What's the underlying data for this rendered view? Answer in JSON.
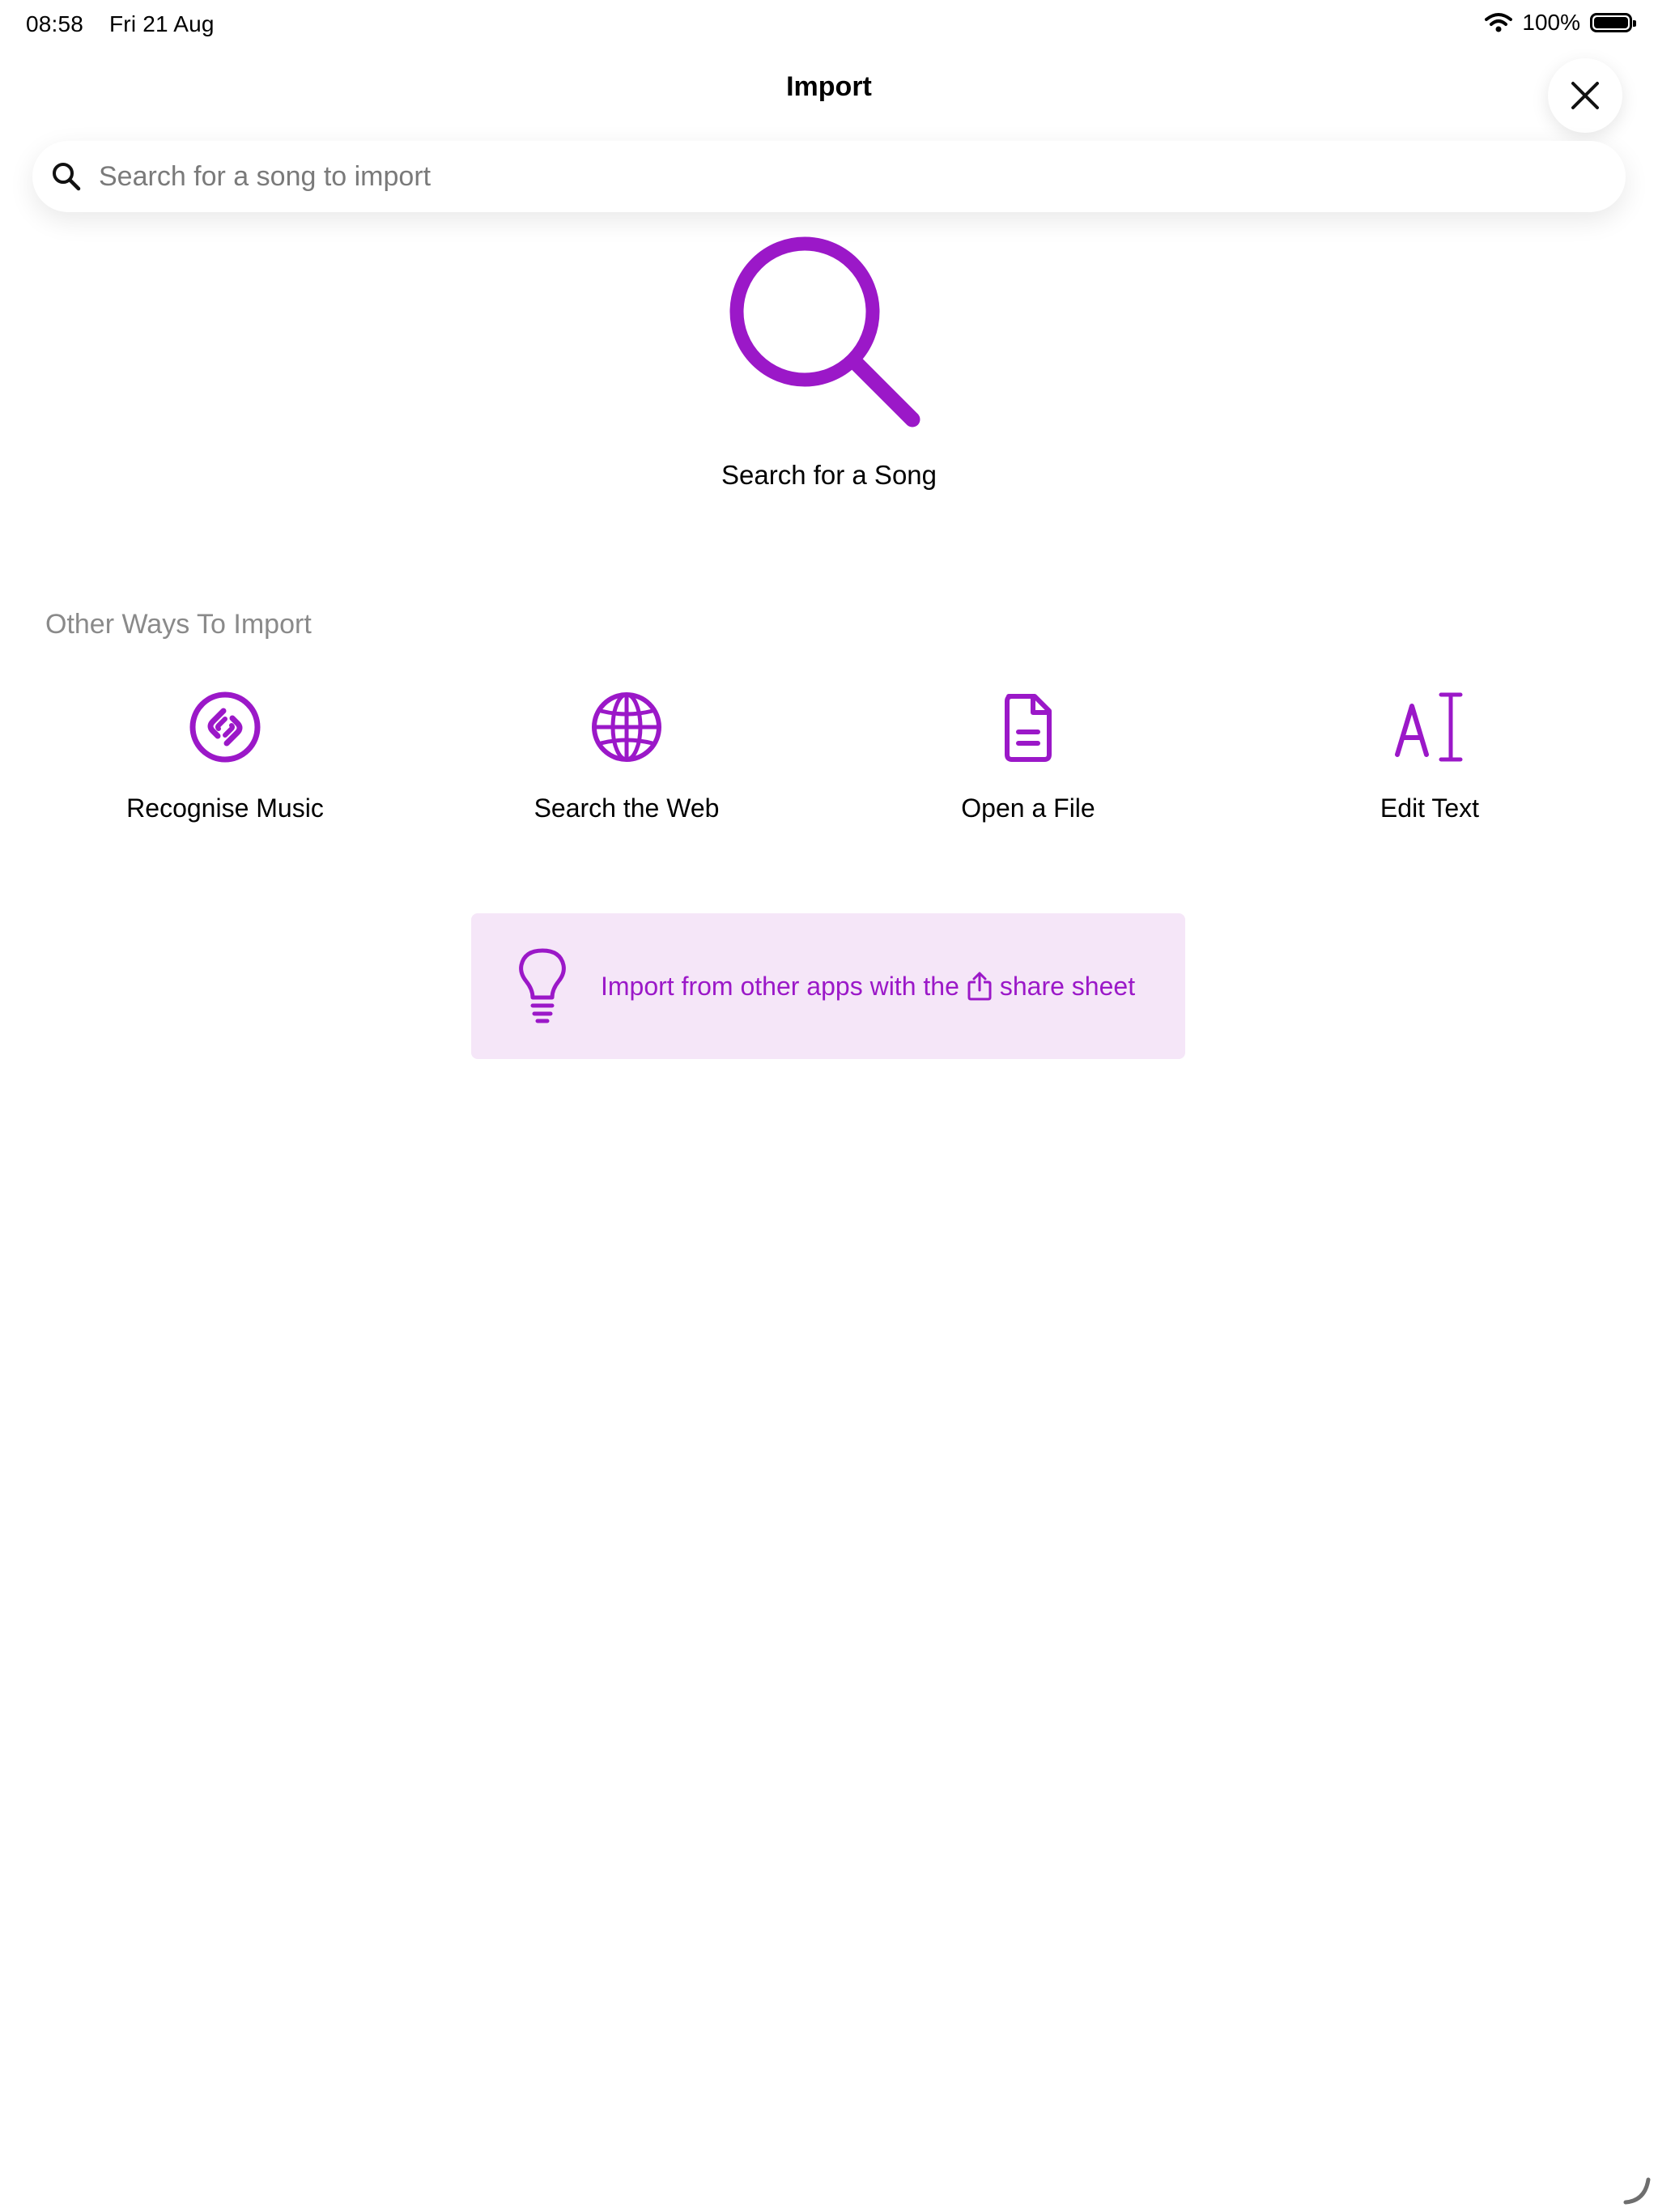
{
  "status_bar": {
    "time": "08:58",
    "date": "Fri 21 Aug",
    "battery": "100%"
  },
  "header": {
    "title": "Import"
  },
  "search": {
    "placeholder": "Search for a song to import"
  },
  "hero": {
    "label": "Search for a Song",
    "icon": "search-icon"
  },
  "other_ways": {
    "title": "Other Ways To Import",
    "options": [
      {
        "label": "Recognise Music",
        "icon": "shazam-icon"
      },
      {
        "label": "Search the Web",
        "icon": "globe-icon"
      },
      {
        "label": "Open a File",
        "icon": "document-icon"
      },
      {
        "label": "Edit Text",
        "icon": "text-cursor-icon"
      }
    ]
  },
  "tip": {
    "text_before": "Import from other apps with the",
    "text_after": "share sheet",
    "icon": "lightbulb-icon"
  },
  "colors": {
    "accent": "#9b18c8",
    "tip_background": "#f5e6f8",
    "section_title": "#8a8a8a"
  }
}
